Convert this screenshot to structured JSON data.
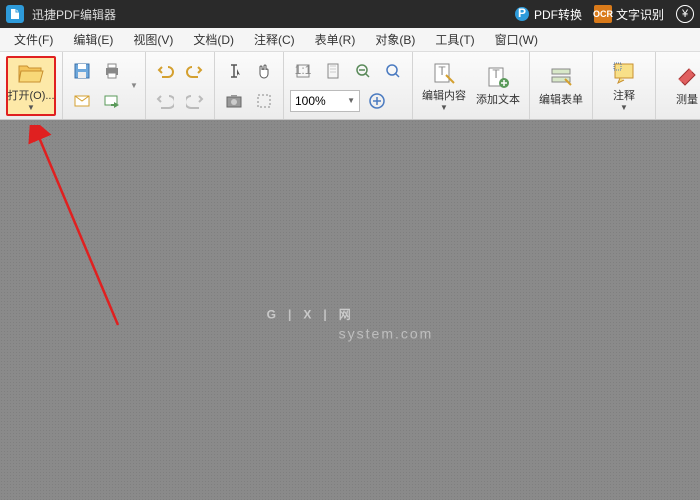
{
  "title": "迅捷PDF编辑器",
  "titlebar": {
    "pdf_convert": "PDF转换",
    "ocr": "文字识别",
    "ocr_badge": "OCR"
  },
  "menu": {
    "file": "文件(F)",
    "edit": "编辑(E)",
    "view": "视图(V)",
    "document": "文档(D)",
    "comment": "注释(C)",
    "form": "表单(R)",
    "object": "对象(B)",
    "tool": "工具(T)",
    "window": "窗口(W)"
  },
  "toolbar": {
    "open": "打开(O)...",
    "edit_content": "编辑内容",
    "add_text": "添加文本",
    "edit_form": "编辑表单",
    "annotate": "注释",
    "measure": "测量",
    "zoom_value": "100%"
  },
  "watermark": {
    "line1_a": "G",
    "line1_b": "X",
    "line1_c": "网",
    "line2": "system.com"
  }
}
